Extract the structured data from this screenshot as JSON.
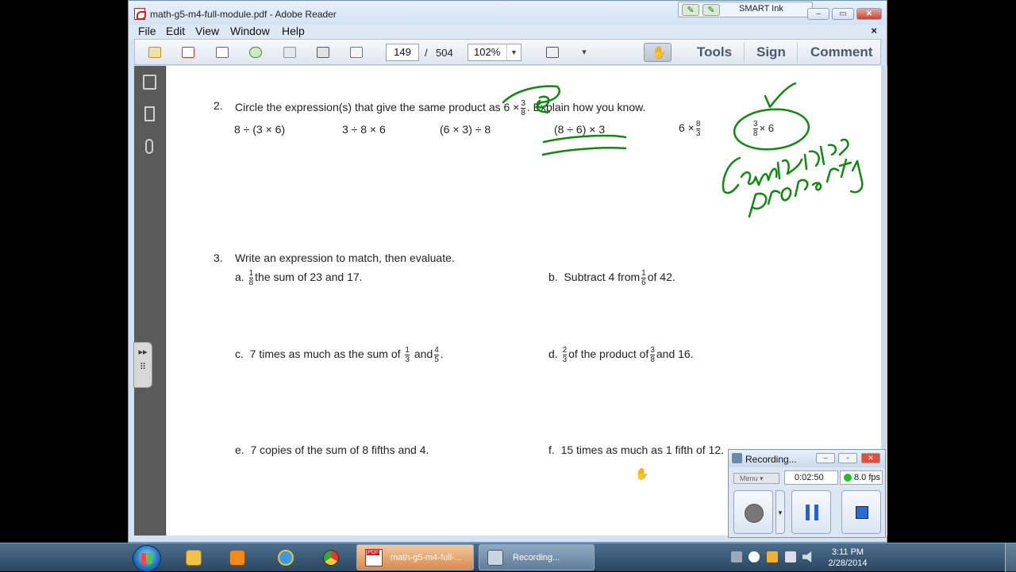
{
  "window": {
    "title": "math-g5-m4-full-module.pdf - Adobe Reader",
    "smart_ink_label": "SMART Ink",
    "minimize": "▭",
    "maximize": "▭",
    "close": "✕"
  },
  "menu": {
    "items": [
      "File",
      "Edit",
      "View",
      "Window",
      "Help"
    ],
    "doc_close": "×"
  },
  "toolbar": {
    "page_current": "149",
    "page_separator": "/",
    "page_total": "504",
    "zoom": "102%",
    "zoom_dropdown": "▼",
    "more": "▾",
    "tabs": [
      "Tools",
      "Sign",
      "Comment"
    ]
  },
  "left_panel": {
    "handle_top": "▸▸",
    "handle_grip": "⠿"
  },
  "document": {
    "q2": {
      "num": "2.",
      "text_a": "Circle the expression(s) that give the same product as 6 ×",
      "frac": {
        "num": "3",
        "den": "8"
      },
      "text_b": ". Explain how you know.",
      "options": [
        "8 ÷ (3 × 6)",
        "3 ÷ 8 × 6",
        "(6 × 3) ÷ 8",
        "(8 ÷ 6) × 3"
      ],
      "opt5_prefix": "6 ×",
      "opt5_frac": {
        "num": "8",
        "den": "3"
      },
      "opt6_frac": {
        "num": "3",
        "den": "8"
      },
      "opt6_suffix": "× 6"
    },
    "q3": {
      "num": "3.",
      "text": "Write an expression to match, then evaluate.",
      "a": {
        "label": "a.",
        "frac": {
          "num": "1",
          "den": "8"
        },
        "text": "the sum of 23 and 17."
      },
      "b": {
        "label": "b.",
        "text_a": "Subtract 4 from",
        "frac": {
          "num": "1",
          "den": "6"
        },
        "text_b": "of 42."
      },
      "c": {
        "label": "c.",
        "text_a": "7 times as much as the sum of",
        "frac1": {
          "num": "1",
          "den": "3"
        },
        "text_b": "and",
        "frac2": {
          "num": "4",
          "den": "5"
        },
        "text_c": "."
      },
      "d": {
        "label": "d.",
        "frac1": {
          "num": "2",
          "den": "3"
        },
        "text_a": "of the product of",
        "frac2": {
          "num": "3",
          "den": "8"
        },
        "text_b": "and 16."
      },
      "e": {
        "label": "e.",
        "text": "7 copies of the sum of 8 fifths and 4."
      },
      "f": {
        "label": "f.",
        "text": "15 times as much as 1 fifth of 12."
      }
    },
    "ink_color": "#118811"
  },
  "recorder": {
    "title": "Recording...",
    "menu_label": "Menu",
    "time": "0:02:50",
    "fps": "8.0 fps"
  },
  "taskbar": {
    "tasks": [
      {
        "label": "math-g5-m4-full-...",
        "badge": "PDF"
      },
      {
        "label": "Recording..."
      }
    ],
    "clock_time": "3:11 PM",
    "clock_date": "2/28/2014"
  },
  "cursor": "✋"
}
